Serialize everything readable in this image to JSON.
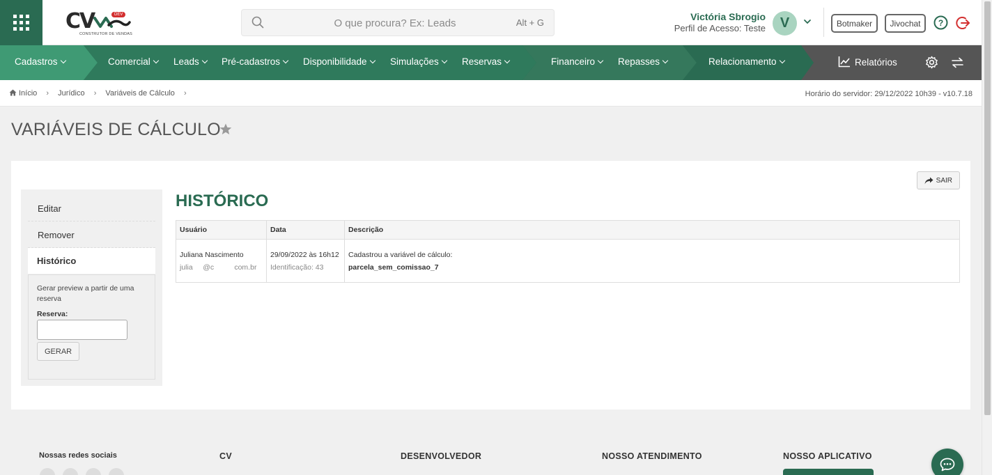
{
  "header": {
    "logo_text": "CV",
    "logo_badge": "DEV",
    "logo_tagline": "CONSTRUTOR DE VENDAS",
    "search_placeholder": "O que procura? Ex: Leads",
    "search_shortcut": "Alt + G",
    "user_name": "Victória Sbrogio",
    "user_profile": "Perfil de Acesso: Teste",
    "avatar_letter": "V",
    "botmaker_label": "Botmaker",
    "jivochat_label": "Jivochat"
  },
  "nav": {
    "items": [
      {
        "label": "Cadastros"
      },
      {
        "label": "Comercial"
      },
      {
        "label": "Leads"
      },
      {
        "label": "Pré-cadastros"
      },
      {
        "label": "Disponibilidade"
      },
      {
        "label": "Simulações"
      },
      {
        "label": "Reservas"
      },
      {
        "label": "Financeiro"
      },
      {
        "label": "Repasses"
      },
      {
        "label": "Relacionamento"
      }
    ],
    "reports_label": "Relatórios"
  },
  "breadcrumb": {
    "items": [
      "Início",
      "Jurídico",
      "Variáveis de Cálculo"
    ],
    "server_info": "Horário do servidor: 29/12/2022 10h39 - v10.7.18"
  },
  "page": {
    "title": "VARIÁVEIS DE CÁLCULO",
    "exit_label": "SAIR"
  },
  "sidebar": {
    "items": [
      {
        "label": "Editar"
      },
      {
        "label": "Remover"
      },
      {
        "label": "Histórico"
      }
    ],
    "preview_text": "Gerar preview a partir de uma reserva",
    "reserva_label": "Reserva:",
    "reserva_value": "",
    "generate_label": "GERAR"
  },
  "history": {
    "title": "HISTÓRICO",
    "columns": [
      "Usuário",
      "Data",
      "Descrição"
    ],
    "rows": [
      {
        "user_name": "Juliana Nascimento",
        "user_email": "julia     @c          com.br",
        "date": "29/09/2022 às 16h12",
        "identification": "Identificação: 43",
        "description": "Cadastrou a variável de cálculo:",
        "variable": "parcela_sem_comissao_7"
      }
    ]
  },
  "footer": {
    "social_title": "Nossas redes sociais",
    "col_cv": "CV",
    "col_dev": "DESENVOLVEDOR",
    "col_support": "NOSSO ATENDIMENTO",
    "col_app": "NOSSO APLICATIVO"
  },
  "colors": {
    "brand": "#2a6b52",
    "brand_light": "#3f9a74",
    "brand_dark": "#35785c",
    "nav_gray": "#555555",
    "danger": "#d32f2f"
  }
}
